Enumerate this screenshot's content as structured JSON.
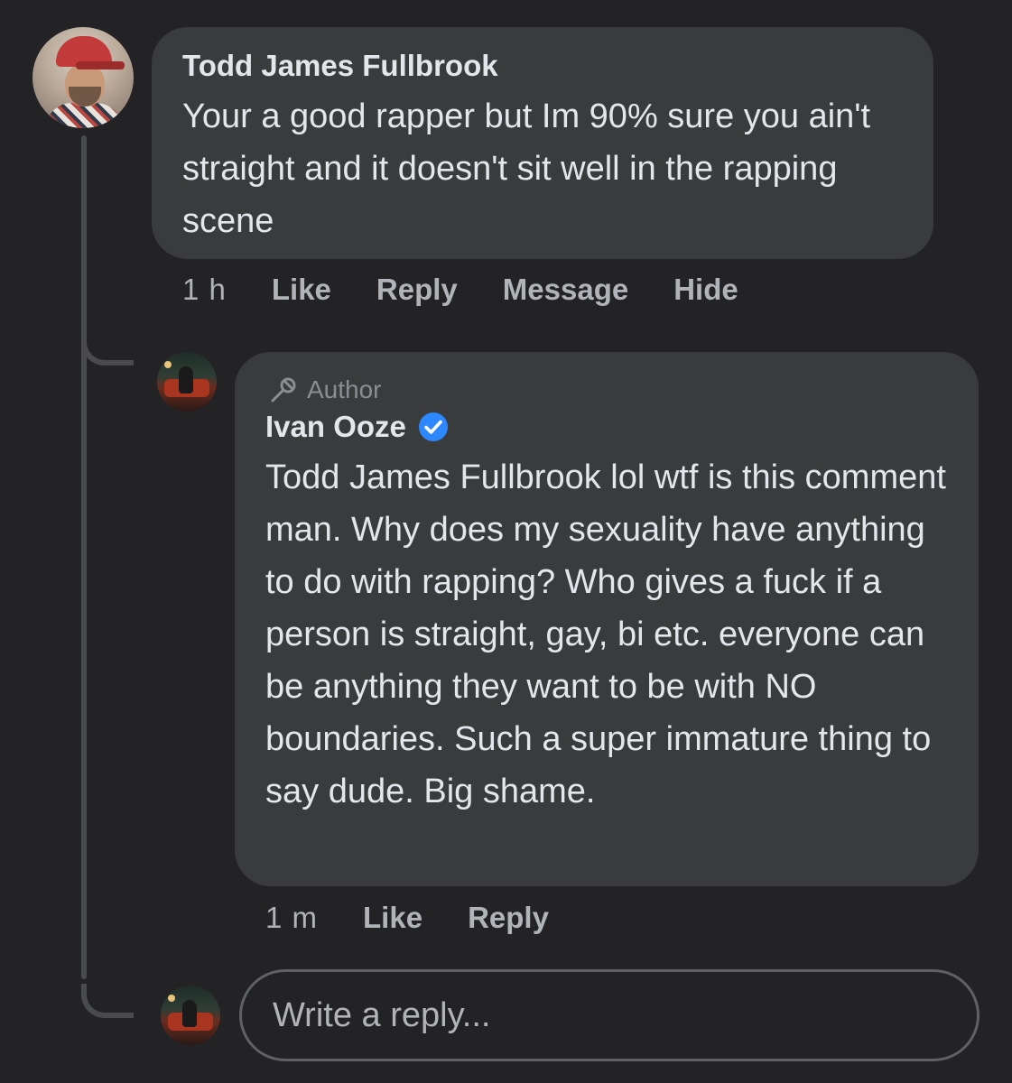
{
  "comment": {
    "author_name": "Todd James Fullbrook",
    "text": "Your a good rapper but Im 90% sure you ain't straight and it doesn't sit well in the rapping scene",
    "timestamp": "1 h",
    "actions": [
      "Like",
      "Reply",
      "Message",
      "Hide"
    ]
  },
  "reply": {
    "badge_label": "Author",
    "author_name": "Ivan Ooze",
    "verified": true,
    "text": "Todd James Fullbrook lol wtf is this comment man. Why does my sexuality have anything to do with rapping? Who gives a fuck if a person is straight, gay, bi etc. everyone can be anything they want to be with NO boundaries. Such a super immature thing to say dude. Big shame.",
    "timestamp": "1 m",
    "actions": [
      "Like",
      "Reply"
    ]
  },
  "reply_box": {
    "placeholder": "Write a reply..."
  },
  "colors": {
    "background": "#232325",
    "bubble": "#3a3b3d",
    "verified_badge": "#2d88ff",
    "muted_text": "#b0b3b8"
  }
}
